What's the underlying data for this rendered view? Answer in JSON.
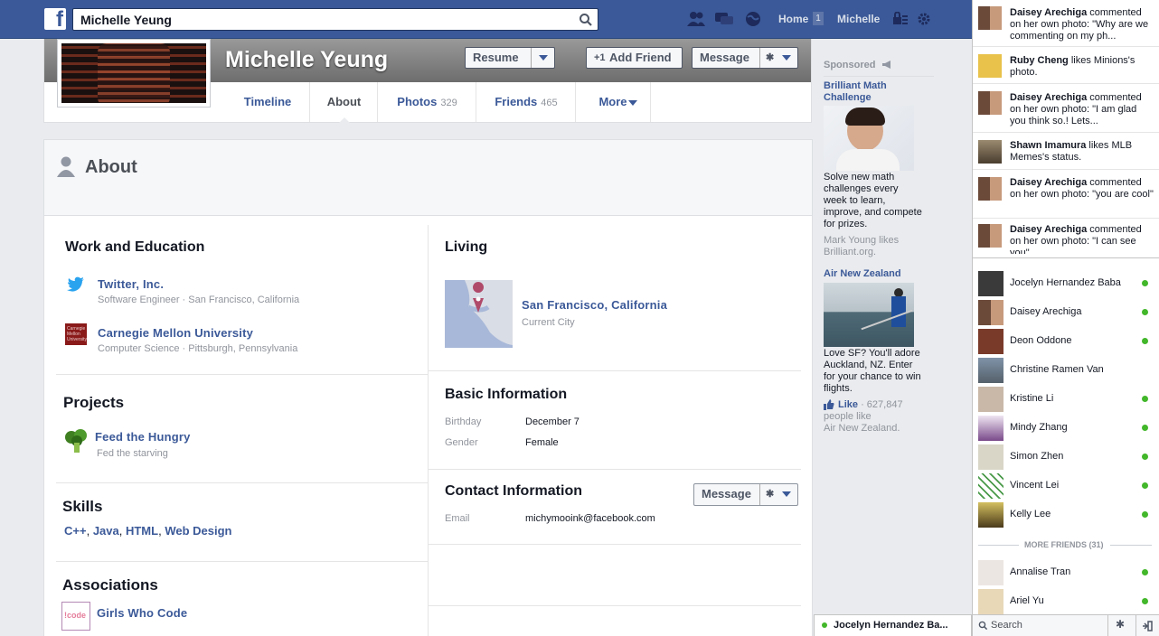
{
  "topbar": {
    "search_value": "Michelle Yeung",
    "home_label": "Home",
    "home_count": "1",
    "user_label": "Michelle"
  },
  "profile": {
    "name": "Michelle Yeung",
    "resume_button": "Resume",
    "add_friend_button": "Add Friend",
    "message_button": "Message",
    "tabs": [
      {
        "label": "Timeline",
        "count": ""
      },
      {
        "label": "About",
        "count": ""
      },
      {
        "label": "Photos",
        "count": "329"
      },
      {
        "label": "Friends",
        "count": "465"
      },
      {
        "label": "More",
        "count": ""
      }
    ]
  },
  "about": {
    "title": "About",
    "work": {
      "title": "Work and Education",
      "items": [
        {
          "name": "Twitter, Inc.",
          "detail": "Software Engineer · San Francisco, California"
        },
        {
          "name": "Carnegie Mellon University",
          "detail": "Computer Science · Pittsburgh, Pennsylvania"
        }
      ]
    },
    "projects": {
      "title": "Projects",
      "name": "Feed the Hungry",
      "detail": "Fed the starving"
    },
    "skills": {
      "title": "Skills",
      "items": [
        "C++",
        "Java",
        "HTML",
        "Web Design"
      ]
    },
    "associations": {
      "title": "Associations",
      "name": "Girls Who Code"
    },
    "living": {
      "title": "Living",
      "city": "San Francisco, California",
      "detail": "Current City"
    },
    "basic": {
      "title": "Basic Information",
      "rows": [
        {
          "key": "Birthday",
          "value": "December 7"
        },
        {
          "key": "Gender",
          "value": "Female"
        }
      ]
    },
    "contact": {
      "title": "Contact Information",
      "message_button": "Message",
      "rows": [
        {
          "key": "Email",
          "value": "michymooink@facebook.com"
        }
      ]
    }
  },
  "sponsored": {
    "label": "Sponsored",
    "ads": [
      {
        "title": "Brilliant Math Challenge",
        "body": "Solve new math challenges every week to learn, improve, and compete for prizes.",
        "social": "Mark Young likes Brilliant.org."
      },
      {
        "title": "Air New Zealand",
        "body": "Love SF? You'll adore Auckland, NZ. Enter for your chance to win flights.",
        "like_label": "Like",
        "like_count": "627,847",
        "social_1": "people like",
        "social_2": "Air New Zealand."
      }
    ]
  },
  "ticker": [
    {
      "actor": "Daisey Arechiga",
      "text": "commented on her own photo: \"Why are we commenting on my ph..."
    },
    {
      "actor": "Ruby Cheng",
      "text": "likes Minions's photo."
    },
    {
      "actor": "Daisey Arechiga",
      "text": "commented on her own photo: \"I am glad you think so.! Lets..."
    },
    {
      "actor": "Shawn Imamura",
      "text": "likes MLB Memes's status."
    },
    {
      "actor": "Daisey Arechiga",
      "text": "commented on her own photo: \"you are cool\""
    },
    {
      "actor": "Daisey Arechiga",
      "text": "commented on her own photo: \"I can see you\""
    }
  ],
  "chat": {
    "friends": [
      "Jocelyn Hernandez Baba",
      "Daisey Arechiga",
      "Deon Oddone",
      "Christine Ramen Van",
      "Kristine Li",
      "Mindy Zhang",
      "Simon Zhen",
      "Vincent Lei",
      "Kelly Lee"
    ],
    "more_label": "MORE FRIENDS (31)",
    "more_friends": [
      "Annalise Tran",
      "Ariel Yu"
    ],
    "search_label": "Search",
    "open_tab": "Jocelyn Hernandez Ba..."
  }
}
